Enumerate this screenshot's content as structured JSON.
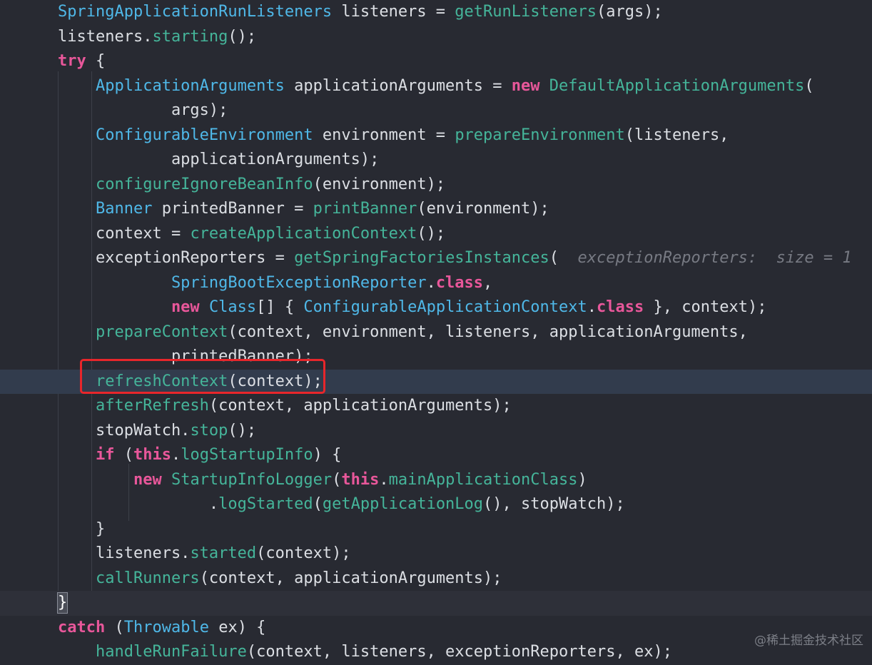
{
  "editor": {
    "lines": [
      {
        "tokens": [
          {
            "t": "SpringApplicationRunListeners",
            "c": "type"
          },
          {
            "t": " listeners = ",
            "c": "var"
          },
          {
            "t": "getRunListeners",
            "c": "fn"
          },
          {
            "t": "(args);",
            "c": "var"
          }
        ]
      },
      {
        "tokens": [
          {
            "t": "listeners.",
            "c": "var"
          },
          {
            "t": "starting",
            "c": "fn"
          },
          {
            "t": "();",
            "c": "var"
          }
        ]
      },
      {
        "tokens": [
          {
            "t": "try",
            "c": "kw"
          },
          {
            "t": " ",
            "c": "var"
          },
          {
            "t": "{",
            "c": "var"
          }
        ]
      },
      {
        "tokens": [
          {
            "t": "    ApplicationArguments",
            "c": "type"
          },
          {
            "t": " applicationArguments = ",
            "c": "var"
          },
          {
            "t": "new",
            "c": "kw"
          },
          {
            "t": " ",
            "c": "var"
          },
          {
            "t": "DefaultApplicationArguments",
            "c": "fn"
          },
          {
            "t": "(",
            "c": "var"
          }
        ]
      },
      {
        "tokens": [
          {
            "t": "            args);",
            "c": "var"
          }
        ]
      },
      {
        "tokens": [
          {
            "t": "    ConfigurableEnvironment",
            "c": "type"
          },
          {
            "t": " environment = ",
            "c": "var"
          },
          {
            "t": "prepareEnvironment",
            "c": "fn"
          },
          {
            "t": "(listeners,",
            "c": "var"
          }
        ]
      },
      {
        "tokens": [
          {
            "t": "            applicationArguments);",
            "c": "var"
          }
        ]
      },
      {
        "tokens": [
          {
            "t": "    configureIgnoreBeanInfo",
            "c": "fn"
          },
          {
            "t": "(environment);",
            "c": "var"
          }
        ]
      },
      {
        "tokens": [
          {
            "t": "    Banner",
            "c": "type"
          },
          {
            "t": " printedBanner = ",
            "c": "var"
          },
          {
            "t": "printBanner",
            "c": "fn"
          },
          {
            "t": "(environment);",
            "c": "var"
          }
        ]
      },
      {
        "tokens": [
          {
            "t": "    context = ",
            "c": "var"
          },
          {
            "t": "createApplicationContext",
            "c": "fn"
          },
          {
            "t": "();",
            "c": "var"
          }
        ]
      },
      {
        "tokens": [
          {
            "t": "    exceptionReporters = ",
            "c": "var"
          },
          {
            "t": "getSpringFactoriesInstances",
            "c": "fn"
          },
          {
            "t": "(  ",
            "c": "var"
          },
          {
            "t": "exceptionReporters:  size = 1",
            "c": "hint"
          }
        ]
      },
      {
        "tokens": [
          {
            "t": "            SpringBootExceptionReporter",
            "c": "type"
          },
          {
            "t": ".",
            "c": "var"
          },
          {
            "t": "class",
            "c": "kw"
          },
          {
            "t": ",",
            "c": "var"
          }
        ]
      },
      {
        "tokens": [
          {
            "t": "            new",
            "c": "kw"
          },
          {
            "t": " ",
            "c": "var"
          },
          {
            "t": "Class",
            "c": "type"
          },
          {
            "t": "[] { ",
            "c": "var"
          },
          {
            "t": "ConfigurableApplicationContext",
            "c": "type"
          },
          {
            "t": ".",
            "c": "var"
          },
          {
            "t": "class",
            "c": "kw"
          },
          {
            "t": " }, context);",
            "c": "var"
          }
        ]
      },
      {
        "tokens": [
          {
            "t": "    prepareContext",
            "c": "fn"
          },
          {
            "t": "(context, environment, listeners, applicationArguments,",
            "c": "var"
          }
        ]
      },
      {
        "tokens": [
          {
            "t": "            printedBanner);",
            "c": "var"
          }
        ]
      },
      {
        "tokens": [
          {
            "t": "    refreshContext",
            "c": "fn"
          },
          {
            "t": "(context);",
            "c": "var"
          }
        ],
        "current": true
      },
      {
        "tokens": [
          {
            "t": "    afterRefresh",
            "c": "fn"
          },
          {
            "t": "(context, applicationArguments);",
            "c": "var"
          }
        ]
      },
      {
        "tokens": [
          {
            "t": "    stopWatch.",
            "c": "var"
          },
          {
            "t": "stop",
            "c": "fn"
          },
          {
            "t": "();",
            "c": "var"
          }
        ]
      },
      {
        "tokens": [
          {
            "t": "    if",
            "c": "kw"
          },
          {
            "t": " (",
            "c": "var"
          },
          {
            "t": "this",
            "c": "kw"
          },
          {
            "t": ".",
            "c": "var"
          },
          {
            "t": "logStartupInfo",
            "c": "fld"
          },
          {
            "t": ") {",
            "c": "var"
          }
        ]
      },
      {
        "tokens": [
          {
            "t": "        new",
            "c": "kw"
          },
          {
            "t": " ",
            "c": "var"
          },
          {
            "t": "StartupInfoLogger",
            "c": "fn"
          },
          {
            "t": "(",
            "c": "var"
          },
          {
            "t": "this",
            "c": "kw"
          },
          {
            "t": ".",
            "c": "var"
          },
          {
            "t": "mainApplicationClass",
            "c": "fld"
          },
          {
            "t": ")",
            "c": "var"
          }
        ]
      },
      {
        "tokens": [
          {
            "t": "                .",
            "c": "var"
          },
          {
            "t": "logStarted",
            "c": "fn"
          },
          {
            "t": "(",
            "c": "var"
          },
          {
            "t": "getApplicationLog",
            "c": "fn"
          },
          {
            "t": "(), stopWatch);",
            "c": "var"
          }
        ]
      },
      {
        "tokens": [
          {
            "t": "    }",
            "c": "var"
          }
        ]
      },
      {
        "tokens": [
          {
            "t": "    listeners.",
            "c": "var"
          },
          {
            "t": "started",
            "c": "fn"
          },
          {
            "t": "(context);",
            "c": "var"
          }
        ]
      },
      {
        "tokens": [
          {
            "t": "    callRunners",
            "c": "fn"
          },
          {
            "t": "(context, applicationArguments);",
            "c": "var"
          }
        ]
      },
      {
        "tokens": [
          {
            "t": "}",
            "c": "brace"
          }
        ],
        "braceLine": true
      },
      {
        "tokens": [
          {
            "t": "catch",
            "c": "kw"
          },
          {
            "t": " (",
            "c": "var"
          },
          {
            "t": "Throwable",
            "c": "type"
          },
          {
            "t": " ex) {",
            "c": "var"
          }
        ]
      },
      {
        "tokens": [
          {
            "t": "    handleRunFailure",
            "c": "fn"
          },
          {
            "t": "(context, listeners, exceptionReporters, ex);",
            "c": "var"
          }
        ]
      }
    ]
  },
  "highlight": {
    "target_text": "refreshContext(context);"
  },
  "watermark": {
    "text": "@稀土掘金技术社区"
  },
  "colors": {
    "background": "#282a32",
    "current_line": "#323c4d",
    "keyword": "#e8579a",
    "type": "#4fb8e8",
    "method": "#45b59a",
    "text": "#dcdfe4",
    "hint": "#777a83",
    "annotation_box": "#e8262b"
  }
}
